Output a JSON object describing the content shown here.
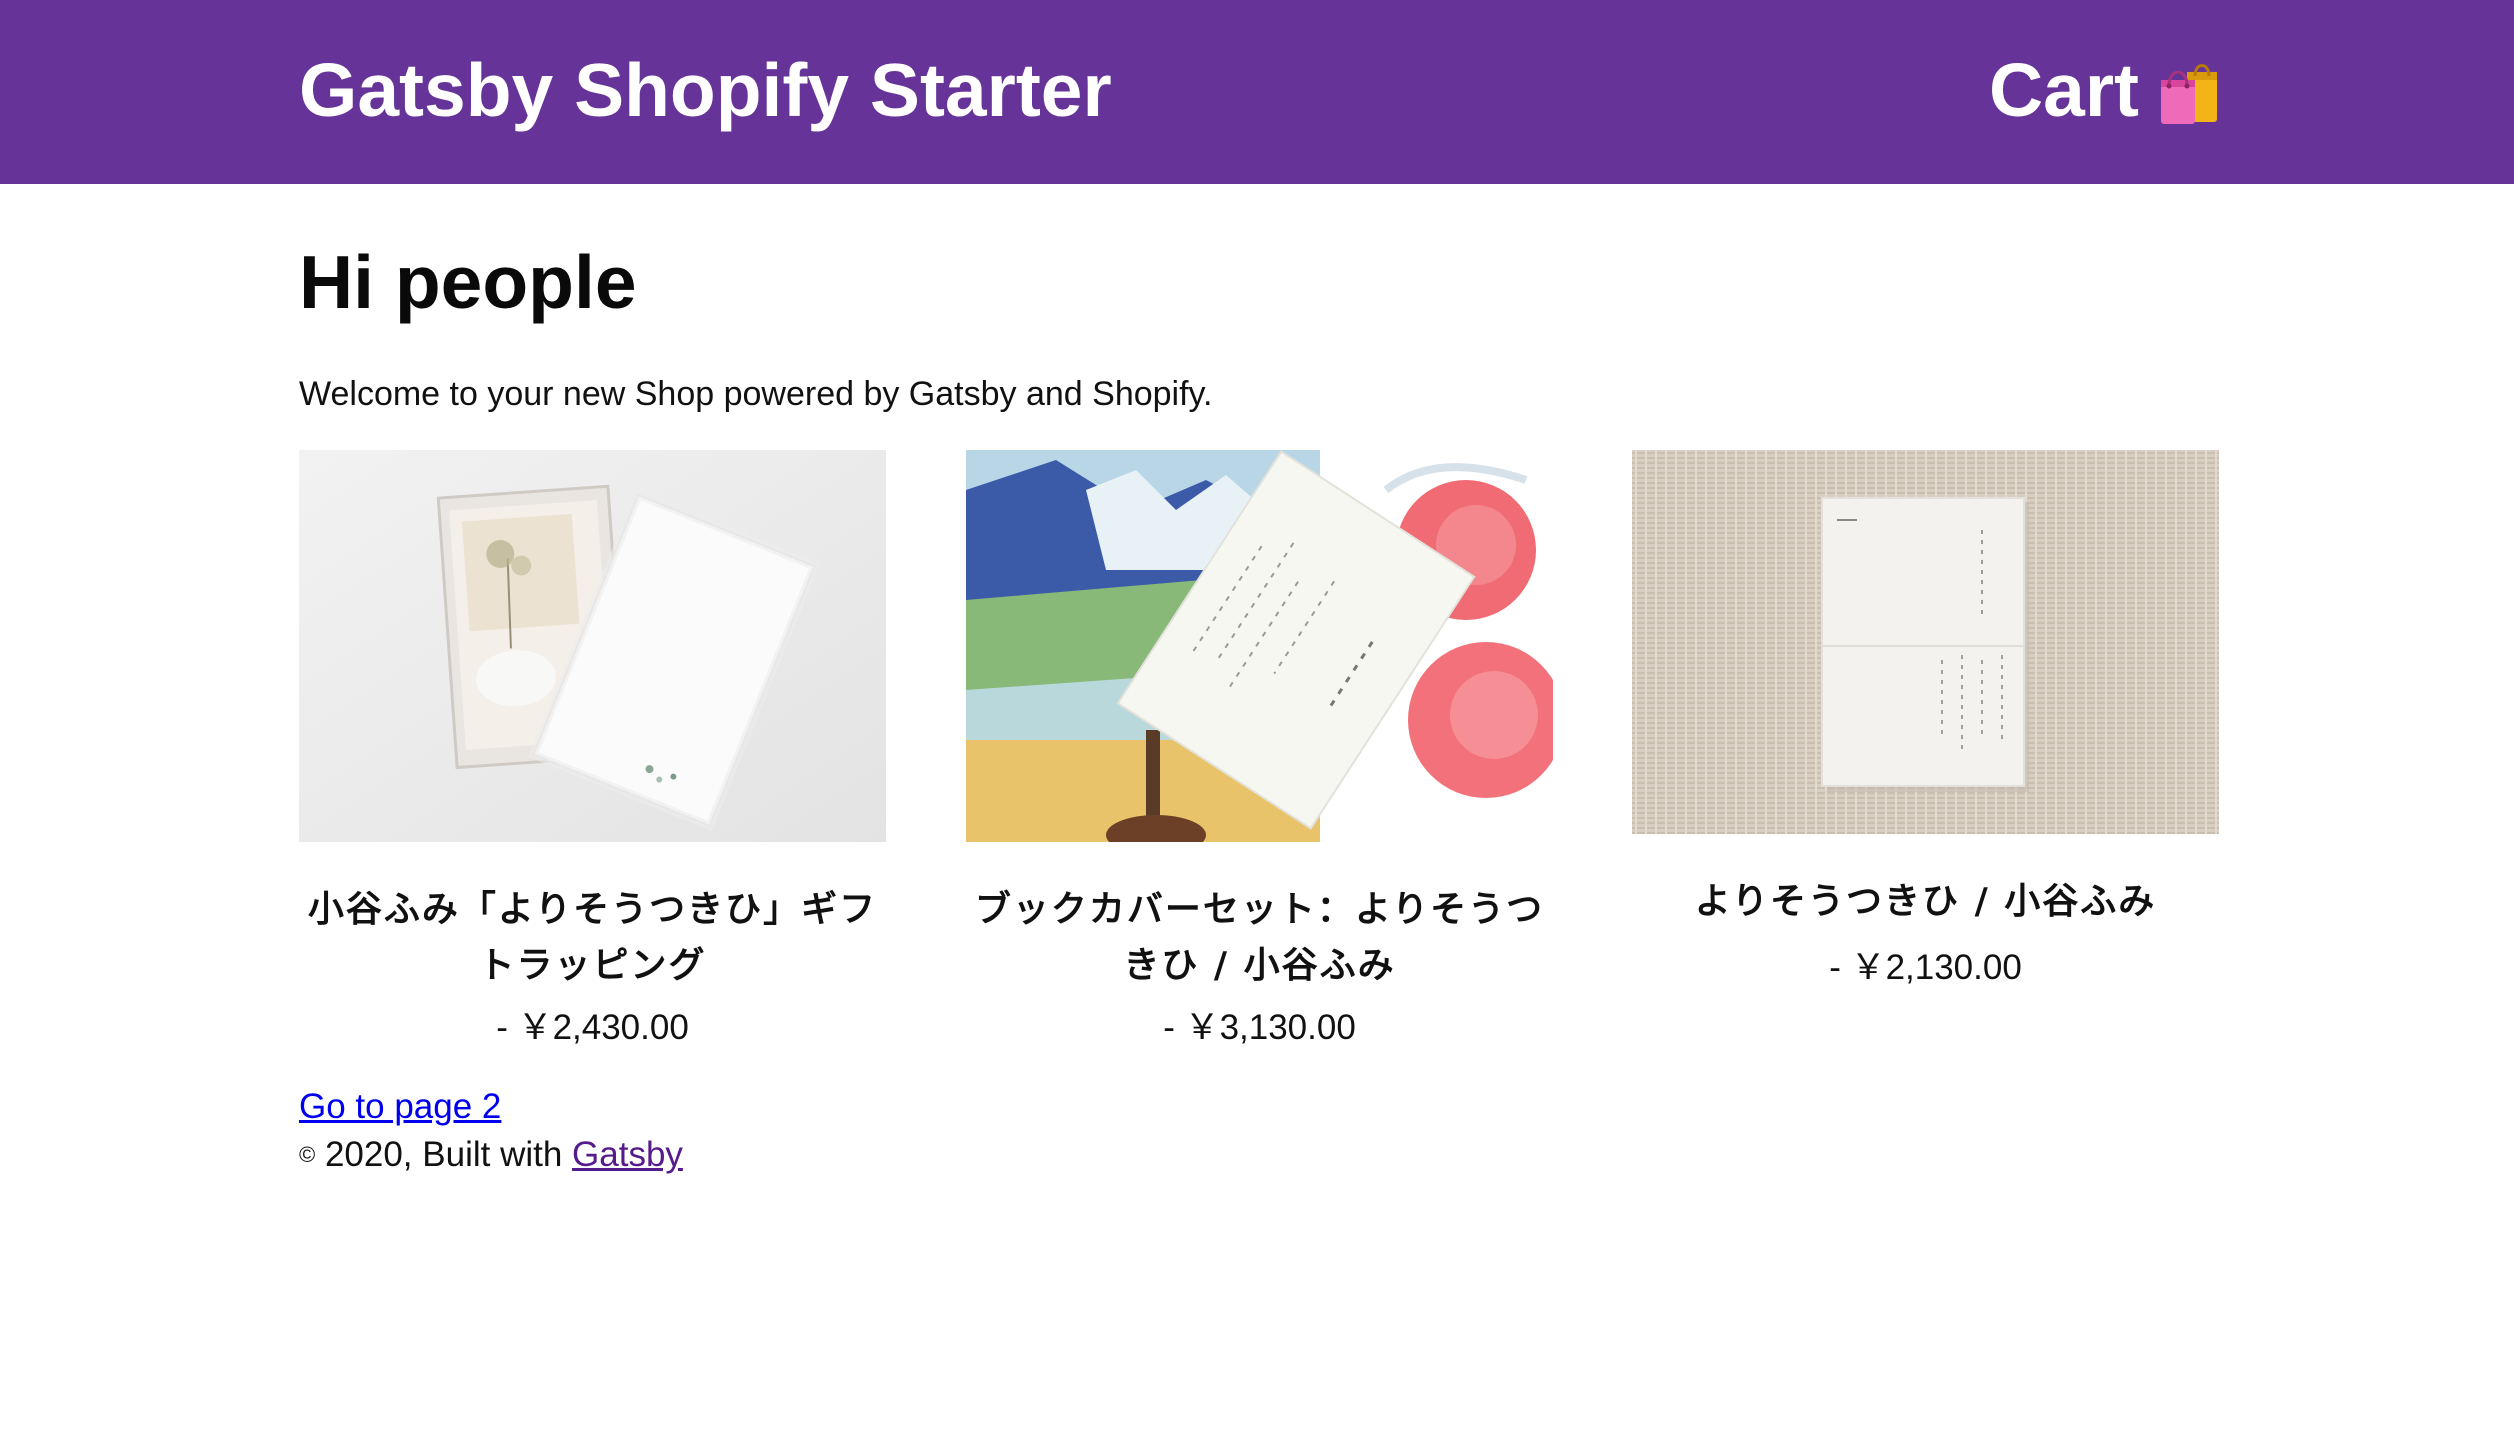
{
  "header": {
    "site_title": "Gatsby Shopify Starter",
    "cart_label": "Cart",
    "cart_icon": "shopping-bags-icon",
    "background_color": "#663399"
  },
  "main": {
    "heading": "Hi people",
    "intro": "Welcome to your new Shop powered by Gatsby and Shopify."
  },
  "products": [
    {
      "name": "小谷ふみ「よりそうつきひ」ギフトラッピング",
      "price": "- ￥2,430.00",
      "image": "gift-box-photo"
    },
    {
      "name": "ブックカバーセット：よりそうつきひ / 小谷ふみ",
      "price": "- ￥3,130.00",
      "image": "book-cover-set-photo"
    },
    {
      "name": "よりそうつきひ / 小谷ふみ",
      "price": "- ￥2,130.00",
      "image": "book-on-linen-photo"
    }
  ],
  "pagination": {
    "next_link": "Go to page 2"
  },
  "footer": {
    "copyright_symbol": "©",
    "text": " 2020, Built with ",
    "link_label": "Gatsby"
  }
}
